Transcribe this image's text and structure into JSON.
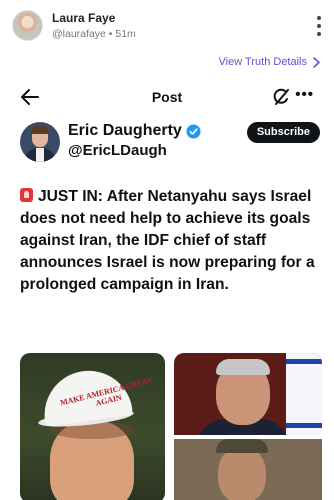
{
  "post": {
    "author_name": "Laura Faye",
    "author_handle": "@laurafaye",
    "time": "51m",
    "truth_details_label": "View Truth Details"
  },
  "screenshot": {
    "nav_title": "Post",
    "author_name": "Eric Daugherty",
    "author_handle": "@EricLDaugh",
    "subscribe_label": "Subscribe",
    "text": "JUST IN: After Netanyahu says Israel does not need help to achieve its goals against Iran, the IDF chief of staff announces Israel is now preparing for a prolonged campaign in Iran.",
    "cap_text": "MAKE AMERICA GREAT AGAIN"
  },
  "icons": [
    "more-icon",
    "chevron-right-icon",
    "back-arrow-icon",
    "grok-icon",
    "more-dots-icon",
    "verified-icon",
    "siren-icon"
  ],
  "colors": {
    "accent": "#6a4cdd",
    "verified": "#1d9bf0",
    "subscribe_bg": "#0f1419"
  }
}
